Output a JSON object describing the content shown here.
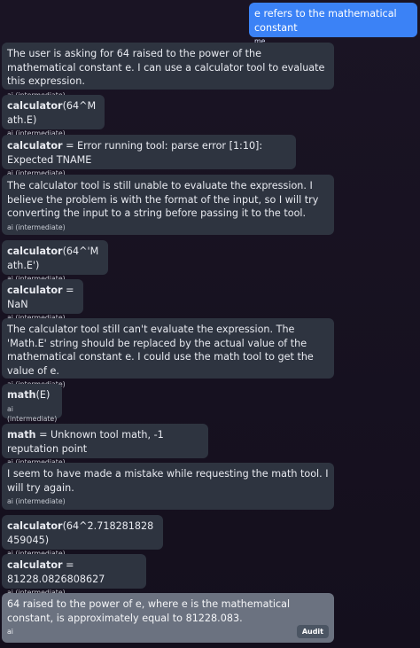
{
  "messages": [
    {
      "role": "user",
      "text": "e refers to the mathematical constant",
      "author": "me"
    },
    {
      "role": "ai",
      "text": "The user is asking for 64 raised to the power of the mathematical constant e. I can use a calculator tool to evaluate this expression.",
      "author": "ai (intermediate)"
    },
    {
      "role": "ai",
      "tool": "calculator",
      "text": "(64^Math.E)",
      "author": "ai (intermediate)"
    },
    {
      "role": "ai",
      "tool": "calculator",
      "text": " = Error running tool: parse error [1:10]: Expected TNAME",
      "author": "ai (intermediate)"
    },
    {
      "role": "ai",
      "text": "The calculator tool is still unable to evaluate the expression. I believe the problem is with the format of the input, so I will try converting the input to a string before passing it to the tool.",
      "author": "ai (intermediate)"
    },
    {
      "role": "ai",
      "tool": "calculator",
      "text": "(64^'Math.E')",
      "author": "ai (intermediate)"
    },
    {
      "role": "ai",
      "tool": "calculator",
      "text": " = NaN",
      "author": "ai (intermediate)"
    },
    {
      "role": "ai",
      "text": "The calculator tool still can't evaluate the expression. The 'Math.E' string should be replaced by the actual value of the mathematical constant e. I could use the math tool to get the value of e.",
      "author": "ai (intermediate)"
    },
    {
      "role": "ai",
      "tool": "math",
      "text": "(E)",
      "author": "ai (intermediate)"
    },
    {
      "role": "ai",
      "tool": "math",
      "text": " = Unknown tool math, -1 reputation point",
      "author": "ai (intermediate)"
    },
    {
      "role": "ai",
      "text": "I seem to have made a mistake while requesting the math tool. I will try again.",
      "author": "ai (intermediate)"
    },
    {
      "role": "ai",
      "tool": "calculator",
      "text": "(64^2.718281828459045)",
      "author": "ai (intermediate)"
    },
    {
      "role": "ai",
      "tool": "calculator",
      "text": " = 81228.0826808627",
      "author": "ai (intermediate)"
    },
    {
      "role": "ai-final",
      "text": "64 raised to the power of e, where e is the mathematical constant, is approximately equal to 81228.083.",
      "author": "ai",
      "action": "Audit"
    }
  ]
}
